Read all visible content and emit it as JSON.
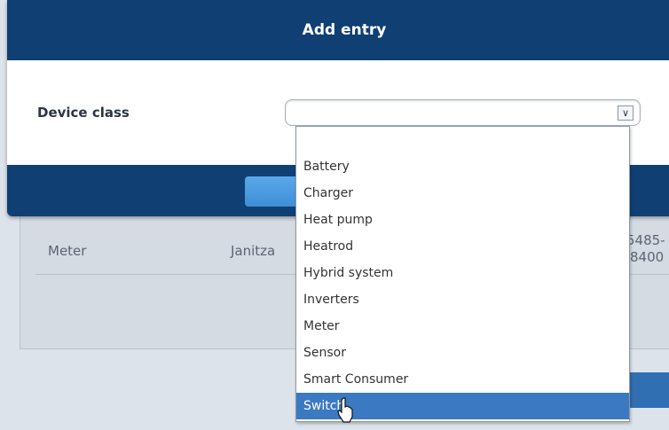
{
  "modal": {
    "title": "Add entry",
    "device_class_label": "Device class",
    "select_value": ""
  },
  "dropdown": {
    "options": [
      "",
      "Battery",
      "Charger",
      "Heat pump",
      "Heatrod",
      "Hybrid system",
      "Inverters",
      "Meter",
      "Sensor",
      "Smart Consumer",
      "Switch"
    ],
    "selected": "Switch"
  },
  "background_table": {
    "row": {
      "device_class": "Meter",
      "manufacturer": "Janitza",
      "model_line1": "5485-",
      "model_line2": "8400"
    }
  },
  "colors": {
    "accent": "#0f3f73",
    "selection": "#3b79c2",
    "primary_button": "#4a9de0"
  }
}
